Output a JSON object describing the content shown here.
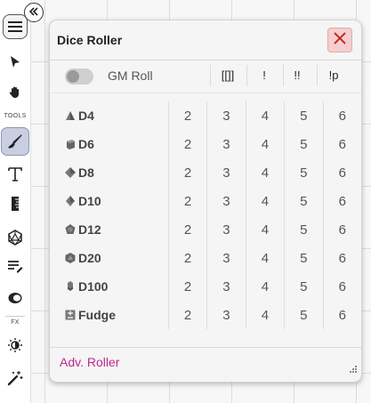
{
  "toolbar": {
    "tools_label": "TOOLS",
    "fx_label": "FX"
  },
  "dice_roller": {
    "title": "Dice Roller",
    "gm_roll_label": "GM Roll",
    "gm_roll_enabled": false,
    "modifiers": [
      "[[]]",
      "!",
      "!!",
      "!p"
    ],
    "dice": [
      {
        "name": "D4",
        "icon": "d4-icon",
        "values": [
          "2",
          "3",
          "4",
          "5",
          "6"
        ]
      },
      {
        "name": "D6",
        "icon": "d6-icon",
        "values": [
          "2",
          "3",
          "4",
          "5",
          "6"
        ]
      },
      {
        "name": "D8",
        "icon": "d8-icon",
        "values": [
          "2",
          "3",
          "4",
          "5",
          "6"
        ]
      },
      {
        "name": "D10",
        "icon": "d10-icon",
        "values": [
          "2",
          "3",
          "4",
          "5",
          "6"
        ]
      },
      {
        "name": "D12",
        "icon": "d12-icon",
        "values": [
          "2",
          "3",
          "4",
          "5",
          "6"
        ]
      },
      {
        "name": "D20",
        "icon": "d20-icon",
        "values": [
          "2",
          "3",
          "4",
          "5",
          "6"
        ]
      },
      {
        "name": "D100",
        "icon": "d100-icon",
        "values": [
          "2",
          "3",
          "4",
          "5",
          "6"
        ]
      },
      {
        "name": "Fudge",
        "icon": "fudge-icon",
        "values": [
          "2",
          "3",
          "4",
          "5",
          "6"
        ]
      }
    ],
    "adv_roller_label": "Adv. Roller",
    "colors": {
      "close_bg": "#f5cfcf",
      "close_x": "#c62828",
      "link": "#c2278f"
    }
  }
}
